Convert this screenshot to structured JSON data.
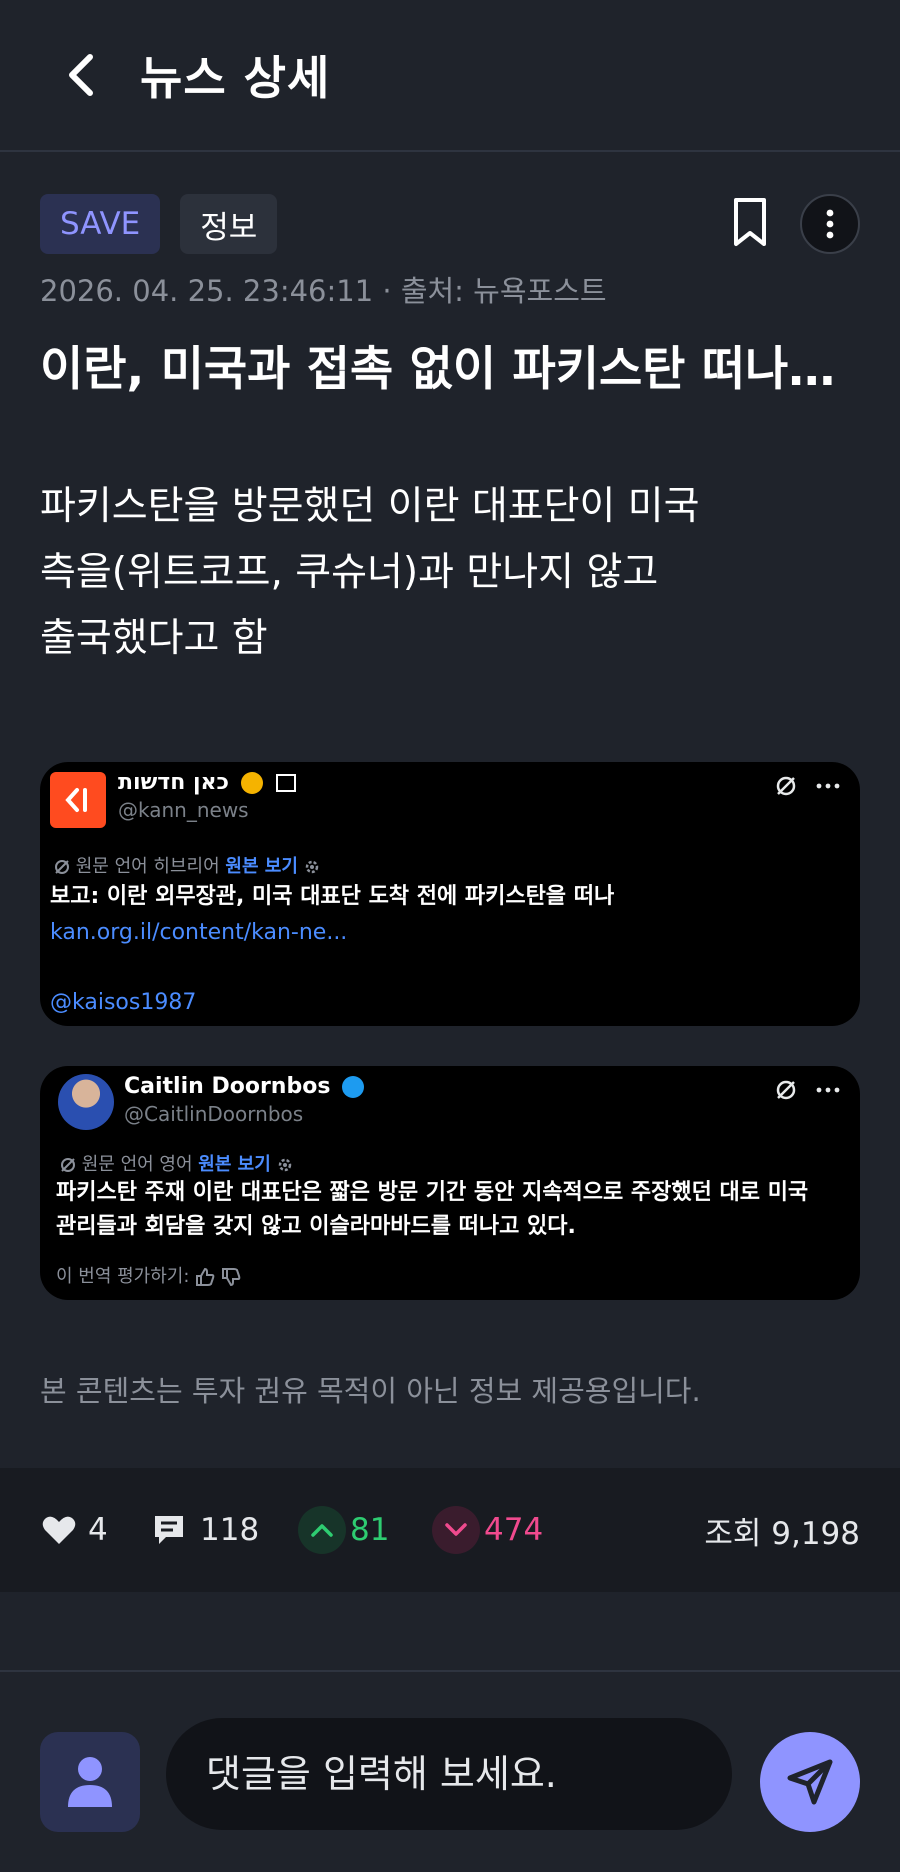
{
  "header": {
    "title": "뉴스 상세"
  },
  "article": {
    "tags": [
      "SAVE",
      "정보"
    ],
    "meta": "2026. 04. 25. 23:46:11 · 출처: 뉴욕포스트",
    "title": "이란, 미국과 접촉 없이 파키스탄 떠나…",
    "body_lines": [
      "파키스탄을 방문했던 이란 대표단이 미국",
      "측을(위트코프, 쿠슈너)과 만나지 않고",
      "출국했다고 함"
    ],
    "disclaimer": "본 콘텐츠는 투자 권유 목적이 아닌 정보 제공용입니다."
  },
  "tweets": [
    {
      "name": "כאן חדשות",
      "handle": "@kann_news",
      "translation_note": "원문 언어 히브리어",
      "view_original": "원본 보기",
      "text": "보고: 이란 외무장관, 미국 대표단 도착 전에 파키스탄을 떠나",
      "link": "kan.org.il/content/kan-ne...",
      "mention": "@kaisos1987"
    },
    {
      "name": "Caitlin Doornbos",
      "handle": "@CaitlinDoornbos",
      "translation_note": "원문 언어 영어",
      "view_original": "원본 보기",
      "text_lines": [
        "파키스탄 주재 이란 대표단은 짧은 방문 기간 동안 지속적으로 주장했던 대로 미국",
        "관리들과 회담을 갖지 않고 이슬라마바드를 떠나고 있다."
      ],
      "rate_label": "이 번역 평가하기:"
    }
  ],
  "stats": {
    "likes": "4",
    "comments": "118",
    "upvotes": "81",
    "downvotes": "474",
    "views": "조회 9,198"
  },
  "comment": {
    "placeholder": "댓글을 입력해 보세요."
  },
  "colors": {
    "background": "#1f232b",
    "accent": "#8f94ff",
    "up": "#2ecc71",
    "down": "#f04a8e",
    "link": "#4b8cff"
  }
}
